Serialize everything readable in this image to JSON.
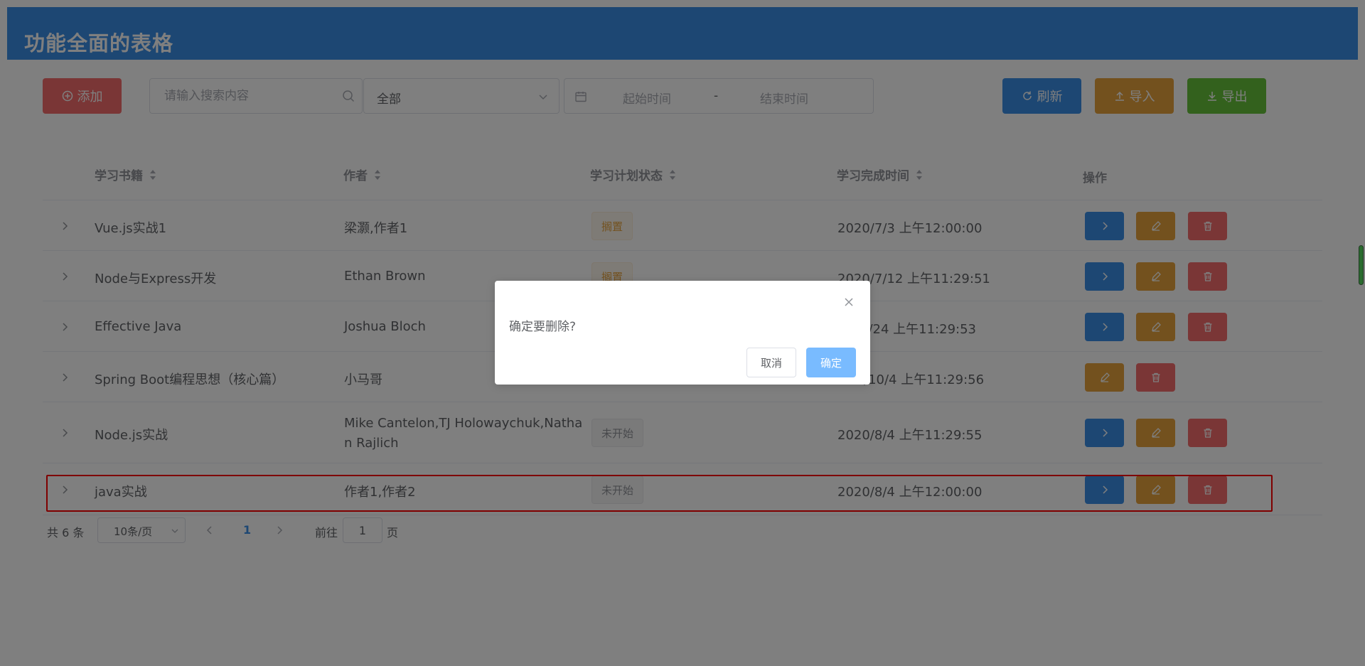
{
  "header": {
    "title": "功能全面的表格"
  },
  "toolbar": {
    "add_label": "添加",
    "search_placeholder": "请输入搜索内容",
    "select_value": "全部",
    "date_start_placeholder": "起始时间",
    "date_separator": "-",
    "date_end_placeholder": "结束时间",
    "refresh_label": "刷新",
    "import_label": "导入",
    "export_label": "导出"
  },
  "table": {
    "columns": [
      "学习书籍",
      "作者",
      "学习计划状态",
      "学习完成时间",
      "操作"
    ],
    "rows": [
      {
        "book": "Vue.js实战1",
        "author": "梁灏,作者1",
        "status": "搁置",
        "date": "2020/7/3 上午12:00:00"
      },
      {
        "book": "Node与Express开发",
        "author": "Ethan Brown",
        "status": "搁置",
        "date": "2020/7/12 上午11:29:51"
      },
      {
        "book": "Effective Java",
        "author": "Joshua Bloch",
        "status": "",
        "date": "7/24 上午11:29:53"
      },
      {
        "book": "Spring Boot编程思想（核心篇）",
        "author": "小马哥",
        "status": "",
        "date": "/10/4 上午11:29:56"
      },
      {
        "book": "Node.js实战",
        "author_line1": "Mike Cantelon,TJ Holowaychuk,Natha",
        "author_line2": "n Rajlich",
        "status": "未开始",
        "date": "2020/8/4 上午11:29:55"
      },
      {
        "book": "java实战",
        "author": "作者1,作者2",
        "status": "未开始",
        "date": "2020/8/4 上午12:00:00"
      }
    ]
  },
  "pagination": {
    "total": "共 6 条",
    "page_size": "10条/页",
    "current": "1",
    "goto_label": "前往",
    "goto_value": "1",
    "goto_unit": "页"
  },
  "dialog": {
    "message": "确定要删除?",
    "cancel_label": "取消",
    "confirm_label": "确定"
  },
  "colors": {
    "primary": "#3a8ee6",
    "warning": "#e6a23c",
    "danger": "#f56c6c",
    "success": "#67c23a",
    "highlight": "#ff0000"
  },
  "icons": [
    "plus-circle-icon",
    "search-icon",
    "chevron-down-icon",
    "calendar-icon",
    "refresh-icon",
    "upload-icon",
    "download-icon",
    "sort-icon",
    "chevron-right-icon",
    "edit-icon",
    "delete-icon",
    "close-icon",
    "chevron-left-icon"
  ]
}
